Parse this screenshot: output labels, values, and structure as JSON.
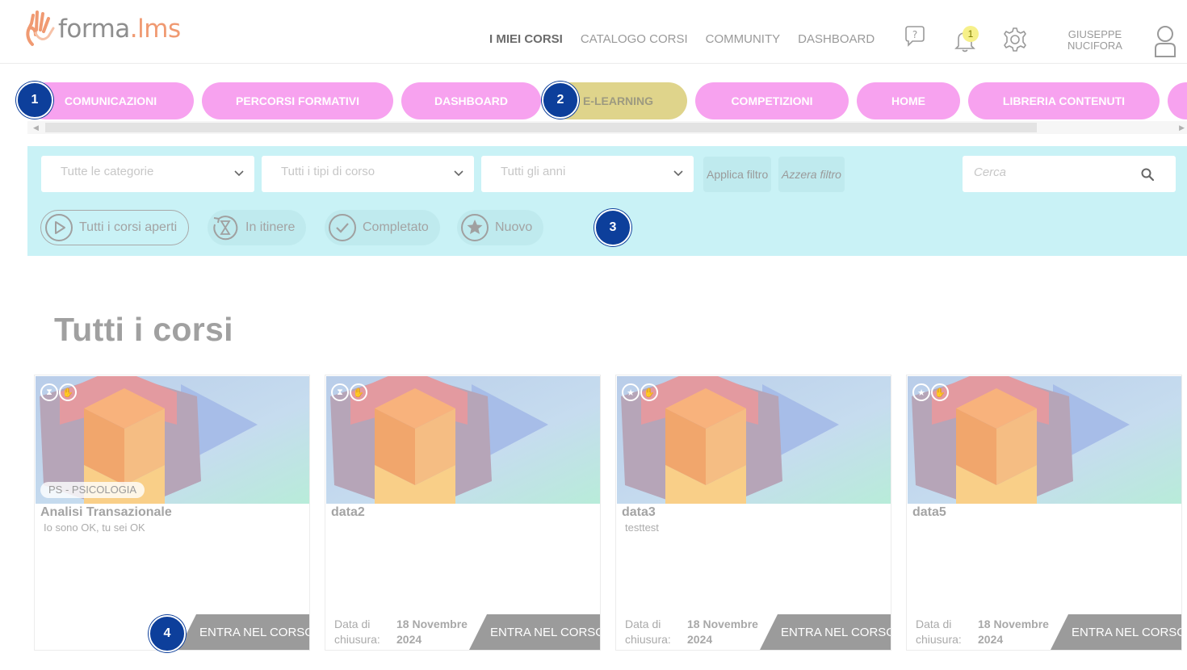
{
  "header": {
    "logo_main": "forma",
    "logo_accent": ".lms",
    "nav": [
      "I MIEI CORSI",
      "CATALOGO CORSI",
      "COMMUNITY",
      "DASHBOARD"
    ],
    "notification_count": "1",
    "user_first": "GIUSEPPE",
    "user_last": "NUCIFORA"
  },
  "tabs": [
    {
      "label": "COMUNICAZIONI"
    },
    {
      "label": "PERCORSI FORMATIVI"
    },
    {
      "label": "DASHBOARD"
    },
    {
      "label": "E-LEARNING",
      "selected": true
    },
    {
      "label": "COMPETIZIONI"
    },
    {
      "label": "HOME"
    },
    {
      "label": "LIBRERIA CONTENUTI"
    }
  ],
  "filters": {
    "category": "Tutte le categorie",
    "course_type": "Tutti i tipi di corso",
    "year": "Tutti gli anni",
    "apply": "Applica filtro",
    "reset": "Azzera filtro",
    "search_placeholder": "Cerca",
    "statuses": [
      "Tutti i corsi aperti",
      "In itinere",
      "Completato",
      "Nuovo"
    ]
  },
  "markers": [
    "1",
    "2",
    "3",
    "4"
  ],
  "section_title": "Tutti i corsi",
  "cards": [
    {
      "title": "Analisi Transazionale",
      "description": "Io sono OK, tu sei OK",
      "category": "PS - PSICOLOGIA",
      "date_label": "",
      "date_value": "",
      "button": "ENTRA NEL CORSO",
      "status_icon": "hourglass-icon"
    },
    {
      "title": "data2",
      "description": "",
      "category": "",
      "date_label": "Data di chiusura:",
      "date_value": "18 Novembre 2024",
      "button": "ENTRA NEL CORSO",
      "status_icon": "hourglass-icon"
    },
    {
      "title": "data3",
      "description": "testtest",
      "category": "",
      "date_label": "Data di chiusura:",
      "date_value": "18 Novembre 2024",
      "button": "ENTRA NEL CORSO",
      "status_icon": "star-icon"
    },
    {
      "title": "data5",
      "description": "",
      "category": "",
      "date_label": "Data di chiusura:",
      "date_value": "18 Novembre 2024",
      "button": "ENTRA NEL CORSO",
      "status_icon": "star-icon"
    }
  ],
  "colors": {
    "tab_pink": "#f7a2ef",
    "tab_selected": "#dfd48b",
    "filter_bg": "#c9f2f6",
    "marker_blue": "#0d3f9b",
    "button_gray": "#9b9b9b"
  }
}
